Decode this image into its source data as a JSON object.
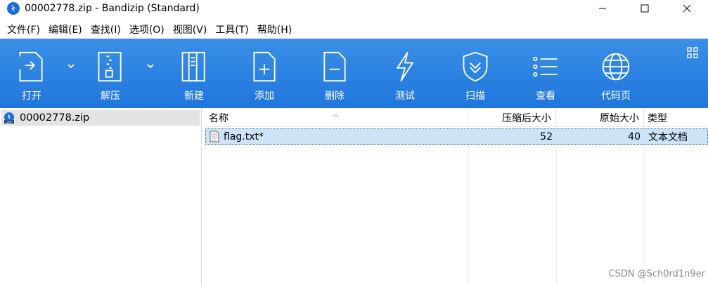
{
  "window": {
    "title": "00002778.zip - Bandizip (Standard)"
  },
  "menu": [
    "文件(F)",
    "编辑(E)",
    "查找(I)",
    "选项(O)",
    "视图(V)",
    "工具(T)",
    "帮助(H)"
  ],
  "toolbar": {
    "open": "打开",
    "extract": "解压",
    "new": "新建",
    "add": "添加",
    "delete": "删除",
    "test": "测试",
    "scan": "扫描",
    "view": "查看",
    "codepage": "代码页"
  },
  "tree": {
    "archive": "00002778.zip"
  },
  "columns": {
    "name": "名称",
    "compressed": "压缩后大小",
    "original": "原始大小",
    "type": "类型"
  },
  "files": [
    {
      "name": "flag.txt*",
      "compressed": "52",
      "original": "40",
      "type": "文本文档"
    }
  ],
  "watermark": "CSDN @Sch0rd1n9er",
  "colors": {
    "toolbar": "#2680e0",
    "selection": "#cde4f7",
    "tree_selection": "#e3e3e3"
  }
}
